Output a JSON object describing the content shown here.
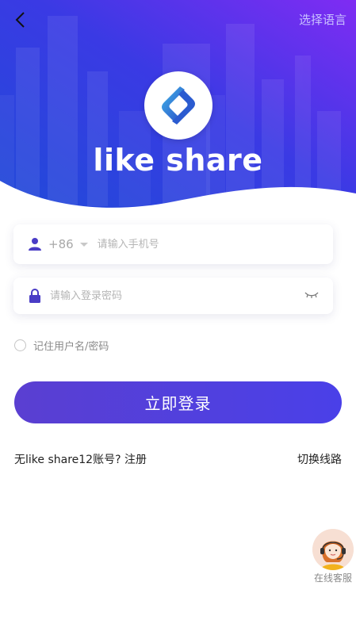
{
  "header": {
    "language_label": "选择语言",
    "logo_text": "like share"
  },
  "login": {
    "country_code": "+86",
    "phone_placeholder": "请输入手机号",
    "password_placeholder": "请输入登录密码",
    "remember_label": "记住用户名/密码",
    "login_button": "立即登录",
    "register_text": "无like share12账号?  注册",
    "switch_line": "切换线路"
  },
  "support": {
    "label": "在线客服"
  },
  "colors": {
    "hero_gradient_start": "#2a3fd6",
    "hero_gradient_end": "#7a2cf2",
    "button_start": "#5a3fd1",
    "button_end": "#4a40e8"
  }
}
